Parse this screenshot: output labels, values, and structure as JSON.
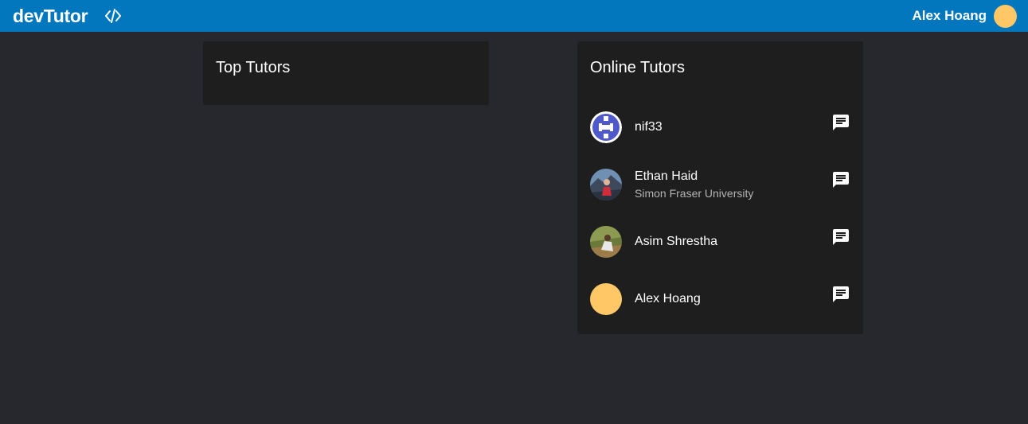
{
  "appbar": {
    "brand": "devTutor",
    "code_icon": "code-brackets-icon",
    "user_name": "Alex Hoang",
    "user_avatar_color": "#ffc766",
    "background": "#0277bd"
  },
  "top_tutors": {
    "title": "Top Tutors"
  },
  "online_tutors": {
    "title": "Online Tutors",
    "items": [
      {
        "name": "nif33",
        "subtitle": "",
        "avatar": "identicon",
        "chat_icon": "message-icon"
      },
      {
        "name": "Ethan Haid",
        "subtitle": "Simon Fraser University",
        "avatar": "photo",
        "chat_icon": "message-icon"
      },
      {
        "name": "Asim Shrestha",
        "subtitle": "",
        "avatar": "photo",
        "chat_icon": "message-icon"
      },
      {
        "name": "Alex Hoang",
        "subtitle": "",
        "avatar": "solid",
        "chat_icon": "message-icon"
      }
    ]
  }
}
